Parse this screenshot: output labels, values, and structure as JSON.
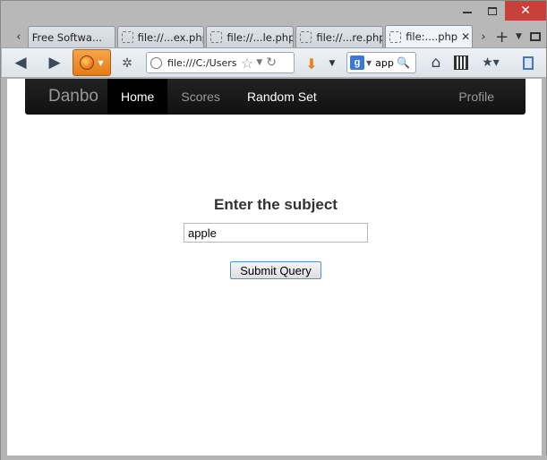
{
  "browser": {
    "tabs": [
      {
        "label": "Free Softwa...",
        "active": false,
        "has_favicon": false
      },
      {
        "label": "file://...ex.php",
        "active": false,
        "has_favicon": true
      },
      {
        "label": "file://...le.php",
        "active": false,
        "has_favicon": true
      },
      {
        "label": "file://...re.php",
        "active": false,
        "has_favicon": true
      },
      {
        "label": "file:....php",
        "active": true,
        "has_favicon": true
      }
    ],
    "address_value": "file:///C:/Users",
    "search_value": "app",
    "icons": [
      "back-arrow-icon",
      "forward-arrow-icon",
      "firefox-icon",
      "extension-icon",
      "globe-icon",
      "star-icon",
      "reload-icon",
      "download-icon",
      "google-icon",
      "search-icon",
      "home-icon",
      "qr-code-icon",
      "bookmarks-icon",
      "sidebar-icon"
    ]
  },
  "site_nav": {
    "brand": "Danbo",
    "links": [
      "Home",
      "Scores",
      "Random Set"
    ],
    "right_link": "Profile"
  },
  "form": {
    "title": "Enter the subject",
    "input_value": "apple",
    "submit_label": "Submit Query"
  },
  "colors": {
    "nav_background": "#111111",
    "nav_active": "#000000",
    "close_button": "#c7413a",
    "firefox_button": "#e8841a"
  }
}
